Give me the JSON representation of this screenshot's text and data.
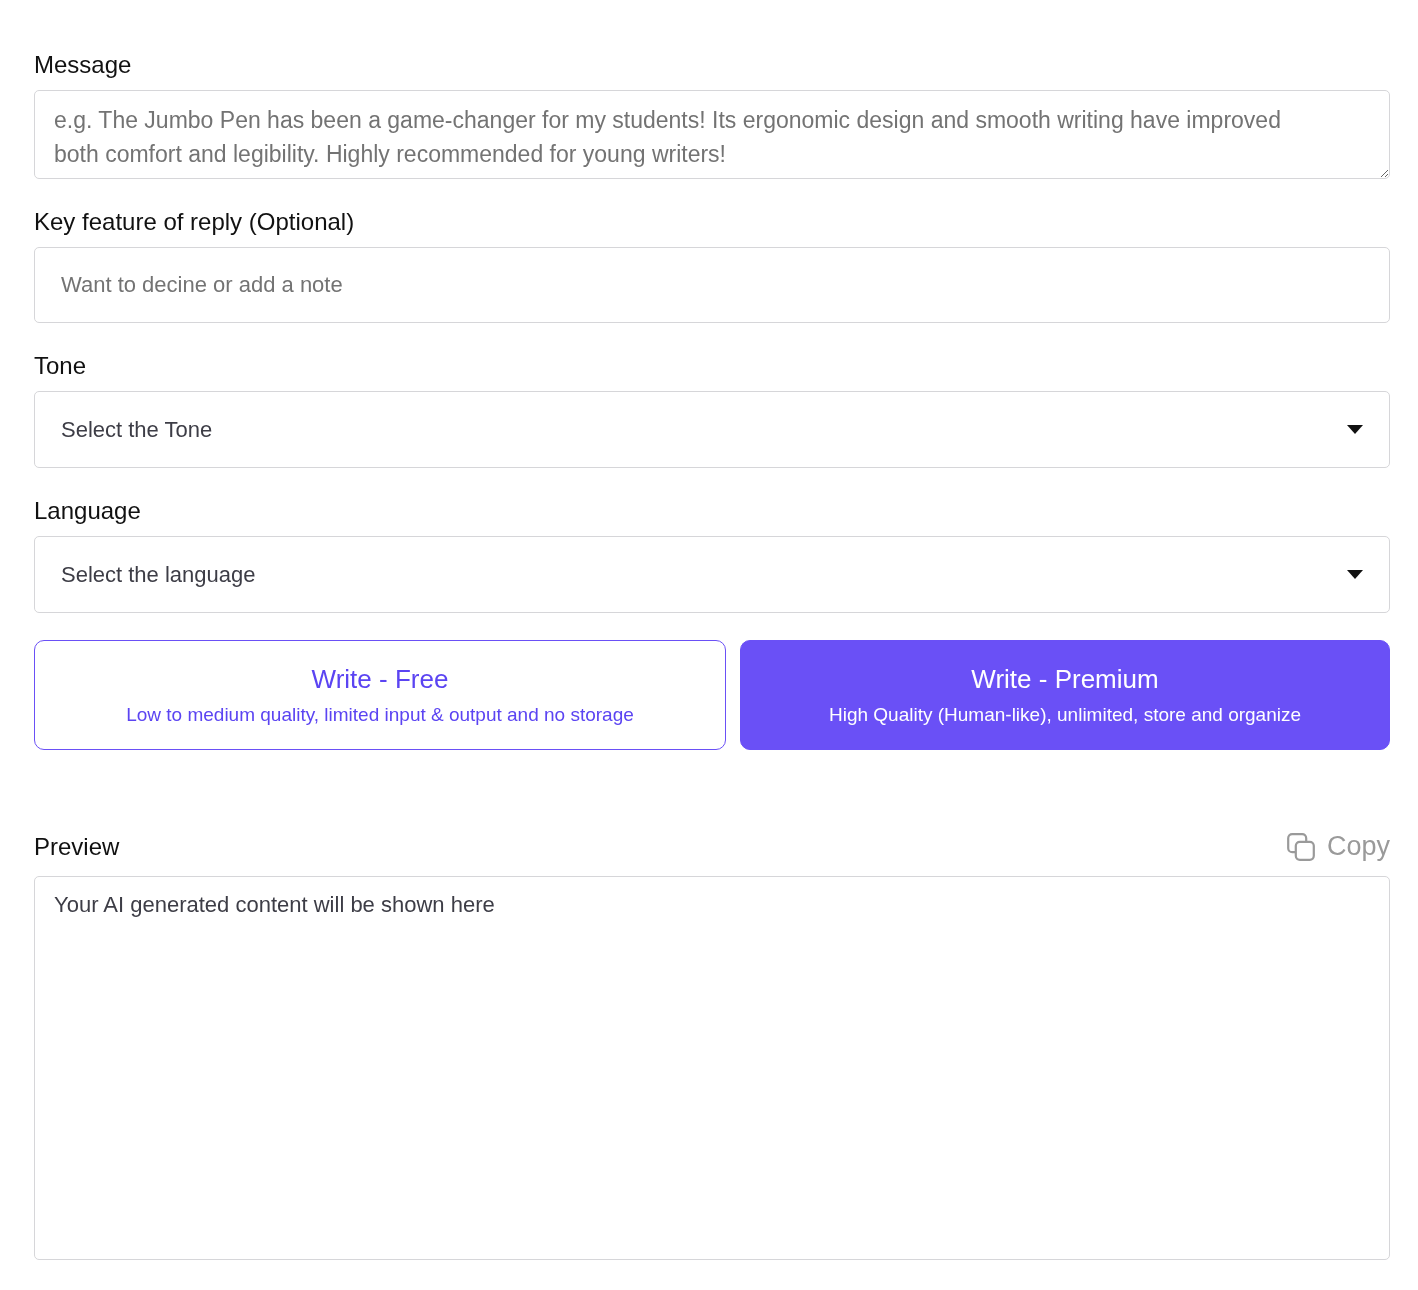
{
  "fields": [
    {
      "kind": "textarea",
      "label": "Message",
      "placeholder": "e.g. The Jumbo Pen has been a game-changer for my students! Its ergonomic design and smooth writing have improved both comfort and legibility. Highly recommended for young writers!"
    },
    {
      "kind": "input",
      "label": "Key feature of reply (Optional)",
      "placeholder": "Want to decine or add a note"
    },
    {
      "kind": "select",
      "label": "Tone",
      "value": "Select the Tone"
    },
    {
      "kind": "select",
      "label": "Language",
      "value": "Select the language"
    }
  ],
  "write_buttons": [
    {
      "kind": "outline",
      "title": "Write - Free",
      "subtitle": "Low to medium quality, limited input & output and no storage"
    },
    {
      "kind": "filled",
      "title": "Write - Premium",
      "subtitle": "High Quality (Human-like), unlimited, store and organize"
    }
  ],
  "preview": {
    "label": "Preview",
    "copy_label": "Copy",
    "content": "Your AI generated content will be shown here"
  }
}
